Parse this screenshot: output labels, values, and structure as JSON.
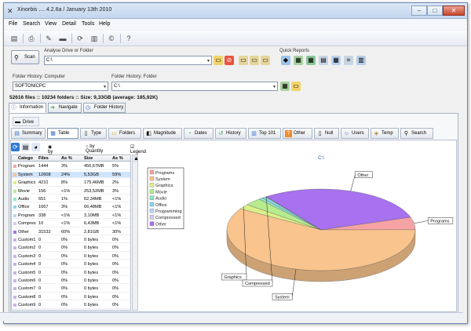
{
  "window": {
    "title": "Xinorbis .... 4.2.6a / January 13th 2010"
  },
  "menu": [
    "File",
    "Search",
    "View",
    "Detail",
    "Tools",
    "Help"
  ],
  "analyse": {
    "scan_label": "Scan",
    "drive_label": "Analyse Drive or Folder",
    "drive_value": "C:\\",
    "quick_reports_label": "Quick Reports"
  },
  "history": {
    "computer_label": "Folder History: Computer",
    "computer_value": "SOFTONICPC",
    "folder_label": "Folder History: Folder",
    "folder_value": "C:\\"
  },
  "status_line": "52616 files :: 10234 folders :: Size: 9,33GB (average: 185,92K)",
  "main_tabs": [
    "Information",
    "Navigate",
    "Folder History"
  ],
  "drive_button": "Drive",
  "view_tabs": [
    "Summary",
    "Table",
    "Type",
    "Folders",
    "Magnitude",
    "Dates",
    "History",
    "Top 101",
    "Other",
    "Null",
    "Users",
    "Temp",
    "Search"
  ],
  "options": {
    "by_size": "by Size",
    "by_quantity": "by Quantity",
    "legend": "Legend"
  },
  "table": {
    "headers": [
      "Catego",
      "Files",
      "As %",
      "Size",
      "As %"
    ],
    "rows": [
      [
        "Program",
        "1444",
        "3%",
        "456,67MB",
        "5%"
      ],
      [
        "System",
        "12608",
        "24%",
        "5,53GB",
        "59%"
      ],
      [
        "Graphics",
        "4210",
        "8%",
        "175,46MB",
        "2%"
      ],
      [
        "Movie",
        "156",
        "<1%",
        "253,52MB",
        "3%"
      ],
      [
        "Audio",
        "651",
        "1%",
        "62,34MB",
        "<1%"
      ],
      [
        "Office",
        "1667",
        "3%",
        "66,48MB",
        "<1%"
      ],
      [
        "Program",
        "338",
        "<1%",
        "3,10MB",
        "<1%"
      ],
      [
        "Compres",
        "10",
        "<1%",
        "6,43MB",
        "<1%"
      ],
      [
        "Other",
        "31532",
        "60%",
        "2,81GB",
        "30%"
      ],
      [
        "Custom1",
        "0",
        "0%",
        "0 bytes",
        "0%"
      ],
      [
        "Custom2",
        "0",
        "0%",
        "0 bytes",
        "0%"
      ],
      [
        "Custom3",
        "0",
        "0%",
        "0 bytes",
        "0%"
      ],
      [
        "Custom4",
        "0",
        "0%",
        "0 bytes",
        "0%"
      ],
      [
        "Custom5",
        "0",
        "0%",
        "0 bytes",
        "0%"
      ],
      [
        "Custom6",
        "0",
        "0%",
        "0 bytes",
        "0%"
      ],
      [
        "Custom7",
        "0",
        "0%",
        "0 bytes",
        "0%"
      ],
      [
        "Custom8",
        "0",
        "0%",
        "0 bytes",
        "0%"
      ],
      [
        "Custom9",
        "0",
        "0%",
        "0 bytes",
        "0%"
      ],
      [
        "Custom1",
        "0",
        "0%",
        "0 bytes",
        "0%"
      ]
    ]
  },
  "chart_data": {
    "type": "pie",
    "title": "C:\\",
    "legend": [
      "Programs",
      "System",
      "Graphics",
      "Movie",
      "Audio",
      "Office",
      "Programming",
      "Compressed",
      "Other"
    ],
    "colors": [
      "#f6a3a3",
      "#f9c48d",
      "#dcef8a",
      "#b6ec8e",
      "#8fe7c3",
      "#8ad6ef",
      "#b8d7f6",
      "#d8c9f3",
      "#a771f0"
    ],
    "values": [
      5,
      59,
      2,
      3,
      0.7,
      0.7,
      0.1,
      0.1,
      30
    ],
    "slice_labels": [
      "Programs",
      "System",
      "Graphics",
      "",
      "",
      "",
      "",
      "Compressed",
      "Other"
    ],
    "legend_position": "top-left"
  }
}
